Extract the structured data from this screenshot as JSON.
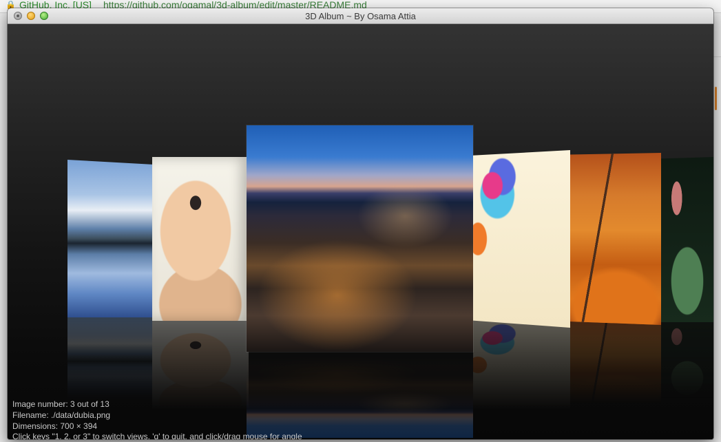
{
  "background_browser": {
    "site_label": "GitHub, Inc. [US]",
    "url": "https://github.com/ogamal/3d-album/edit/master/README.md"
  },
  "window": {
    "title": "3D Album ~ By Osama Attia"
  },
  "status": {
    "image_number": "Image number: 3 out of 13",
    "filename": "Filename: ./data/dubia.png",
    "dimensions": "Dimensions: 700 × 394",
    "help": "Click keys \"1, 2, or 3\" to switch views, 'q' to quit, and click/drag mouse for angle"
  },
  "album": {
    "current_index": 3,
    "total": 13,
    "photos": [
      "lake-mountains-photo",
      "baby-photo",
      "dubai-city-night-photo",
      "colorful-swirl-photo",
      "autumn-park-bench-photo",
      "statue-photo"
    ]
  },
  "colors": {
    "titlebar": "#dcdcdc",
    "viewport_top": "#333333",
    "viewport_bottom": "#070707",
    "status_text": "#c8c8c8"
  }
}
